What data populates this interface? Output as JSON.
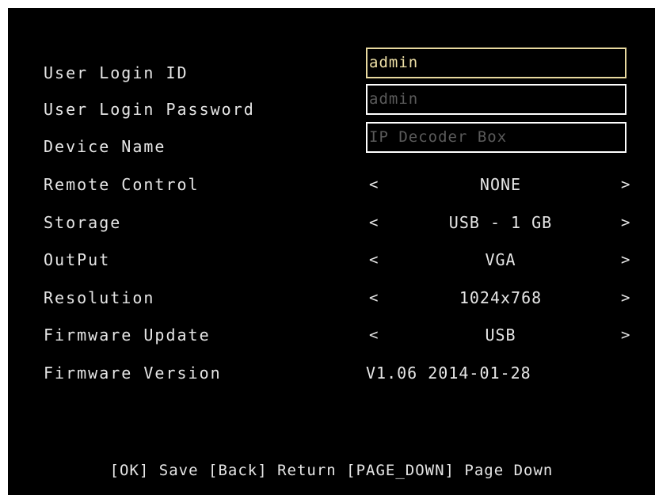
{
  "colors": {
    "background": "#000000",
    "text": "#e6e6e6",
    "active_field_text": "#f0e2a8",
    "active_field_border": "#e8d9a0",
    "inactive_field_text": "#5b5b5b",
    "field_border": "#ffffff"
  },
  "icons": {
    "prev": "chevron-left-icon",
    "next": "chevron-right-icon"
  },
  "arrows": {
    "left": "<",
    "right": ">"
  },
  "settings": {
    "user_login_id": {
      "label": "User Login ID",
      "value": "admin"
    },
    "user_login_password": {
      "label": "User Login Password",
      "value": "admin"
    },
    "device_name": {
      "label": "Device Name",
      "placeholder": "IP Decoder Box"
    },
    "remote_control": {
      "label": "Remote Control",
      "value": "NONE"
    },
    "storage": {
      "label": "Storage",
      "value": "USB - 1 GB"
    },
    "output": {
      "label": "OutPut",
      "value": "VGA"
    },
    "resolution": {
      "label": "Resolution",
      "value": "1024x768"
    },
    "firmware_update": {
      "label": "Firmware Update",
      "value": "USB"
    },
    "firmware_version": {
      "label": "Firmware Version",
      "value": "V1.06 2014-01-28"
    }
  },
  "footer": {
    "hint": "[OK] Save [Back] Return [PAGE_DOWN] Page Down"
  }
}
